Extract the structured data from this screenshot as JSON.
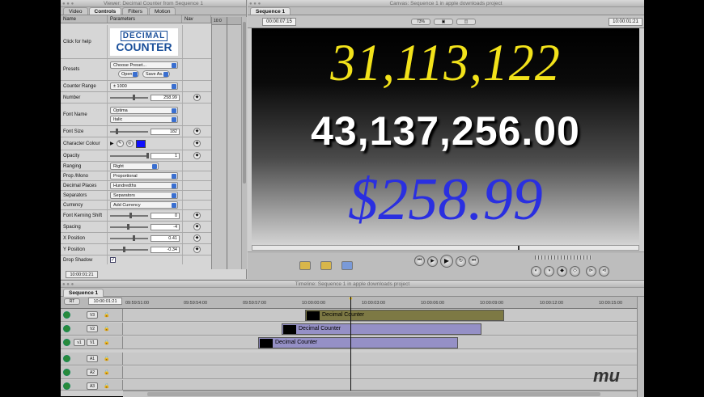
{
  "viewer": {
    "title": "Viewer: Decimal Counter from Sequence 1",
    "tabs": [
      "Video",
      "Controls",
      "Filters",
      "Motion"
    ],
    "headers": {
      "name": "Name",
      "params": "Parameters",
      "nav": "Nav"
    },
    "ruler_time": "10:0",
    "timecode": "10:00:01:21",
    "click_help": "Click for help",
    "logo_line1": "DECIMAL",
    "logo_line2": "COUNTER",
    "presets": {
      "label": "Presets",
      "select": "Choose Preset...",
      "open": "Open",
      "save": "Save As..."
    },
    "counter_range": {
      "label": "Counter Range",
      "value": "± 1000"
    },
    "number": {
      "label": "Number",
      "value": "258.99"
    },
    "font_name": {
      "label": "Font Name",
      "font": "Optima",
      "style": "Italic"
    },
    "font_size": {
      "label": "Font Size",
      "value": "182"
    },
    "char_colour": {
      "label": "Character Colour",
      "color": "#1010ff"
    },
    "opacity": {
      "label": "Opacity",
      "value": "1"
    },
    "ranging": {
      "label": "Ranging",
      "value": "Right"
    },
    "prop_mono": {
      "label": "Prop /Mono",
      "value": "Proportional"
    },
    "decimal_places": {
      "label": "Decimal Places",
      "value": "Hundredths"
    },
    "separators": {
      "label": "Separators",
      "value": "Separators"
    },
    "currency": {
      "label": "Currency",
      "value": "Add Currency"
    },
    "kerning": {
      "label": "Font Kerning Shift",
      "value": "0"
    },
    "spacing": {
      "label": "Spacing",
      "value": "-4"
    },
    "xpos": {
      "label": "X Position",
      "value": "0.41"
    },
    "ypos": {
      "label": "Y Position",
      "value": "-0.34"
    },
    "drop_shadow": {
      "label": "Drop Shadow"
    }
  },
  "canvas": {
    "title": "Canvas: Sequence 1 in apple downloads project",
    "tab": "Sequence 1",
    "tc_left": "00:00:07:15",
    "tc_right": "10:00:01:21",
    "zoom": "73%",
    "num1": "31,113,122",
    "num2": "43,137,256.00",
    "num3": "$258.99"
  },
  "timeline": {
    "title": "Timeline: Sequence 1 in apple downloads project",
    "tab": "Sequence 1",
    "timecode": "10:00:01:21",
    "rt": "RT",
    "ticks": [
      "09:59:51:00",
      "09:59:54:00",
      "09:59:57:00",
      "10:00:00:00",
      "10:00:03:00",
      "10:00:06:00",
      "10:00:09:00",
      "10:00:12:00",
      "10:00:15:00"
    ],
    "tracks": {
      "v3": "V3",
      "v2": "V2",
      "v1": "V1",
      "v1dst": "v1",
      "a1": "A1",
      "a2": "A2",
      "a3": "A3"
    },
    "clip_v3": "Decimal Counter",
    "clip_v2": "Decimal Counter",
    "clip_v1": "Decimal Counter"
  }
}
